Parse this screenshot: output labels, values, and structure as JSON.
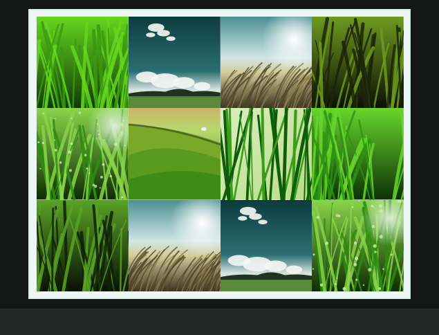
{
  "gallery": {
    "tiles": [
      {
        "name": "grass-closeup-bright",
        "kind": "grass",
        "colors": [
          "#3a9a10",
          "#66d61e",
          "#0f3b06"
        ]
      },
      {
        "name": "sky-clouds-teal",
        "kind": "sky",
        "colors": [
          "#0d3b3d",
          "#2b6f72",
          "#5a8a39"
        ]
      },
      {
        "name": "wheat-sunlight",
        "kind": "wheat",
        "colors": [
          "#cfe6e5",
          "#d7ce9e",
          "#3a331e"
        ]
      },
      {
        "name": "grass-dark-olive",
        "kind": "grass",
        "colors": [
          "#1b2408",
          "#6f9a1f",
          "#0a0f04"
        ]
      },
      {
        "name": "grass-dew-drops",
        "kind": "dew",
        "colors": [
          "#2f8b12",
          "#8ad44a",
          "#0d2d04"
        ]
      },
      {
        "name": "rolling-green-hills",
        "kind": "hills",
        "colors": [
          "#7aa828",
          "#3f8b17",
          "#b6d86c"
        ]
      },
      {
        "name": "grass-blades-light",
        "kind": "blades",
        "colors": [
          "#d9efbf",
          "#3c9d1c",
          "#0f5c0a"
        ]
      },
      {
        "name": "grass-closeup-vivid",
        "kind": "grass",
        "colors": [
          "#2c9413",
          "#68d62c",
          "#0c3106"
        ]
      },
      {
        "name": "grass-dark-green",
        "kind": "grass",
        "colors": [
          "#0f2208",
          "#5aa225",
          "#081103"
        ]
      },
      {
        "name": "wheat-sunlight-2",
        "kind": "wheat",
        "colors": [
          "#cfe6e5",
          "#d7ce9e",
          "#3a331e"
        ]
      },
      {
        "name": "sky-clouds-teal-2",
        "kind": "sky",
        "colors": [
          "#0d3b3d",
          "#2b6f72",
          "#5a8a39"
        ]
      },
      {
        "name": "grass-dew-drops-2",
        "kind": "dew",
        "colors": [
          "#2f8b12",
          "#8ad44a",
          "#0d2d04"
        ]
      }
    ]
  }
}
